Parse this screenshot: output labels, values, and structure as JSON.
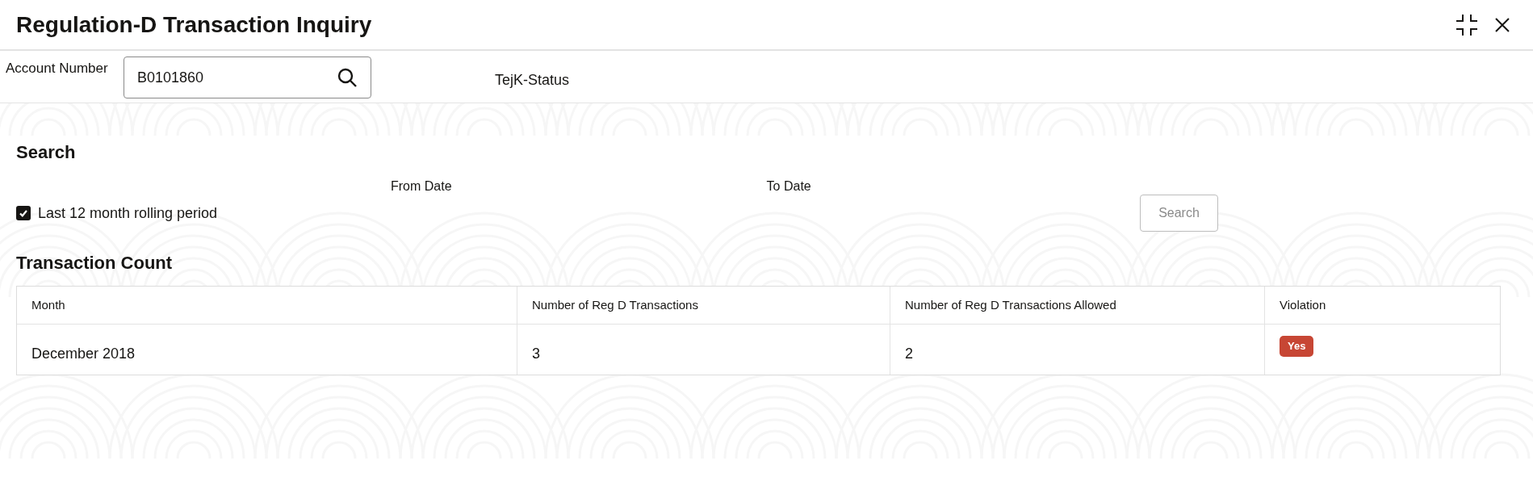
{
  "window": {
    "title": "Regulation-D Transaction Inquiry"
  },
  "account": {
    "label": "Account Number",
    "value": "B0101860",
    "status": "TejK-Status"
  },
  "search": {
    "heading": "Search",
    "from_date_label": "From Date",
    "to_date_label": "To Date",
    "rolling": {
      "label": "Last 12 month rolling period",
      "checked": true
    },
    "button": {
      "label": "Search",
      "disabled": true
    }
  },
  "transaction_count": {
    "heading": "Transaction Count",
    "columns": [
      "Month",
      "Number of Reg D Transactions",
      "Number of Reg D Transactions Allowed",
      "Violation"
    ],
    "rows": [
      {
        "cells": [
          {
            "kind": "text",
            "text": "December 2018"
          },
          {
            "kind": "text",
            "text": "3"
          },
          {
            "kind": "text",
            "text": "2"
          },
          {
            "kind": "badge",
            "text": "Yes",
            "color": "#c74634"
          }
        ]
      }
    ]
  }
}
